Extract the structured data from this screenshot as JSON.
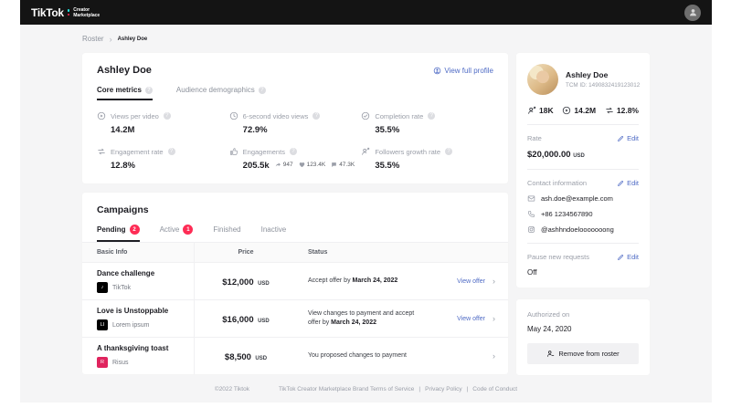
{
  "header": {
    "logo": {
      "brand": "TikTok",
      "sub_line1": "Creator",
      "sub_line2": "Marketplace"
    }
  },
  "breadcrumb": {
    "root": "Roster",
    "separator": "›",
    "current": "Ashley Doe"
  },
  "icons": {
    "chevron_right": "›"
  },
  "profile": {
    "title": "Ashley Doe",
    "view_full_profile": "View full profile",
    "tabs": [
      {
        "label": "Core metrics"
      },
      {
        "label": "Audience demographics"
      }
    ],
    "metrics": [
      {
        "label": "Views per video",
        "value": "14.2M"
      },
      {
        "label": "6-second video views",
        "value": "72.9%"
      },
      {
        "label": "Completion rate",
        "value": "35.5%"
      },
      {
        "label": "Engagement rate",
        "value": "12.8%"
      },
      {
        "label": "Engagements",
        "value": "205.5k",
        "shares": "947",
        "likes": "123.4K",
        "comments": "47.3K"
      },
      {
        "label": "Followers growth rate",
        "value": "35.5%"
      }
    ]
  },
  "campaigns": {
    "title": "Campaigns",
    "tabs": [
      {
        "label": "Pending",
        "badge": "2"
      },
      {
        "label": "Active",
        "badge": "1"
      },
      {
        "label": "Finished"
      },
      {
        "label": "Inactive"
      }
    ],
    "table": {
      "headers": [
        "Basic Info",
        "Price",
        "Status"
      ],
      "rows": [
        {
          "name": "Dance challenge",
          "brand": "TikTok",
          "logo_text": "♪",
          "logo_color": "#000000",
          "price": "$12,000",
          "currency": "USD",
          "status_prefix": "Accept offer by ",
          "status_date": "March 24, 2022",
          "action": "View offer"
        },
        {
          "name": "Love is Unstoppable",
          "brand": "Lorem ipsum",
          "logo_text": "LI",
          "logo_color": "#000000",
          "price": "$16,000",
          "currency": "USD",
          "status_prefix": "View changes to payment and accept offer by ",
          "status_date": "March 24, 2022",
          "action": "View offer"
        },
        {
          "name": "A thanksgiving toast",
          "brand": "Risus",
          "logo_text": "R",
          "logo_color": "#e0245e",
          "price": "$8,500",
          "currency": "USD",
          "status_prefix": "You proposed changes to payment",
          "status_date": "",
          "action": ""
        }
      ]
    }
  },
  "sidebar": {
    "name": "Ashley Doe",
    "tcm_id": "TCM ID: 1490832419123012",
    "stats": [
      {
        "icon": "followers-icon",
        "value": "18K"
      },
      {
        "icon": "play-icon",
        "value": "14.2M"
      },
      {
        "icon": "engagement-icon",
        "value": "12.8%"
      }
    ],
    "rate": {
      "label": "Rate",
      "edit": "Edit",
      "value": "$20,000.00",
      "currency": "USD"
    },
    "contact": {
      "label": "Contact information",
      "edit": "Edit",
      "email": "ash.doe@example.com",
      "phone": "+86 1234567890",
      "instagram": "@ashhndoelooooooong"
    },
    "pause": {
      "label": "Pause new requests",
      "edit": "Edit",
      "value": "Off"
    },
    "authorized": {
      "label": "Authorized on",
      "date": "May 24, 2020"
    },
    "remove_button": "Remove from roster"
  },
  "footer": {
    "copyright": "©2022 Tiktok",
    "separator": "|",
    "links": [
      "TikTok Creator Marketplace Brand Terms of Service",
      "Privacy Policy",
      "Code of Conduct"
    ]
  },
  "colors": {
    "accent_pink": "#fe2c55",
    "accent_teal": "#25f4ee",
    "link_blue": "#4f6bc5",
    "header_black": "#141414",
    "page_bg": "#f5f5f6"
  }
}
